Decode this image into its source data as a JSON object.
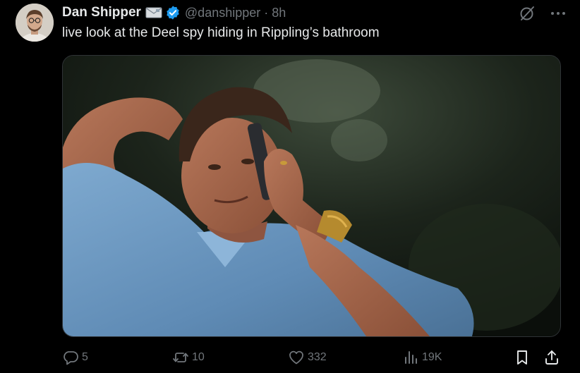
{
  "author": {
    "name": "Dan Shipper",
    "handle": "@danshipper",
    "separator": "·",
    "time": "8h"
  },
  "tweet": {
    "text": "live look at the Deel spy hiding in Rippling’s bathroom"
  },
  "actions": {
    "replies": "5",
    "retweets": "10",
    "likes": "332",
    "views": "19K"
  },
  "icons": {
    "mail": "mail-icon",
    "verified": "verified-badge-icon",
    "grok": "grok-icon",
    "more": "more-options-icon",
    "reply": "reply-icon",
    "retweet": "retweet-icon",
    "like": "heart-icon",
    "views": "views-chart-icon",
    "bookmark": "bookmark-icon",
    "share": "share-icon"
  },
  "colors": {
    "background": "#000000",
    "text": "#e7e9ea",
    "muted": "#71767b",
    "verified": "#1d9bf0",
    "border": "#2f3336"
  }
}
